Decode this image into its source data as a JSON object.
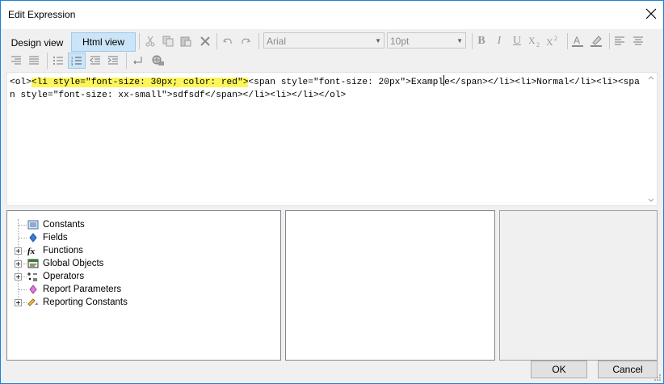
{
  "window": {
    "title": "Edit Expression"
  },
  "toolbar": {
    "design_view": "Design view",
    "html_view": "Html view",
    "font_name": "Arial",
    "font_size": "10pt",
    "bold": "B",
    "italic": "I",
    "underline": "U"
  },
  "editor": {
    "highlighted": "<li style=\"font-size: 30px; color: red\">",
    "before_highlight": "<ol>",
    "line1_rest": "<span style=\"font-size: 20px\">Exampl",
    "after_caret": "e</span></li><li>Normal</li><li><span style=\"font-size: xx-small\">sdfsdf</span></li><li></li></ol>"
  },
  "tree": {
    "items": [
      {
        "label": "Constants",
        "expandable": false
      },
      {
        "label": "Fields",
        "expandable": false
      },
      {
        "label": "Functions",
        "expandable": true
      },
      {
        "label": "Global Objects",
        "expandable": true
      },
      {
        "label": "Operators",
        "expandable": true
      },
      {
        "label": "Report Parameters",
        "expandable": false
      },
      {
        "label": "Reporting Constants",
        "expandable": true
      }
    ]
  },
  "buttons": {
    "ok": "OK",
    "cancel": "Cancel"
  },
  "colors": {
    "highlight": "#fcf55a",
    "active_tab": "#cce4f7",
    "border_accent": "#1883d7"
  }
}
